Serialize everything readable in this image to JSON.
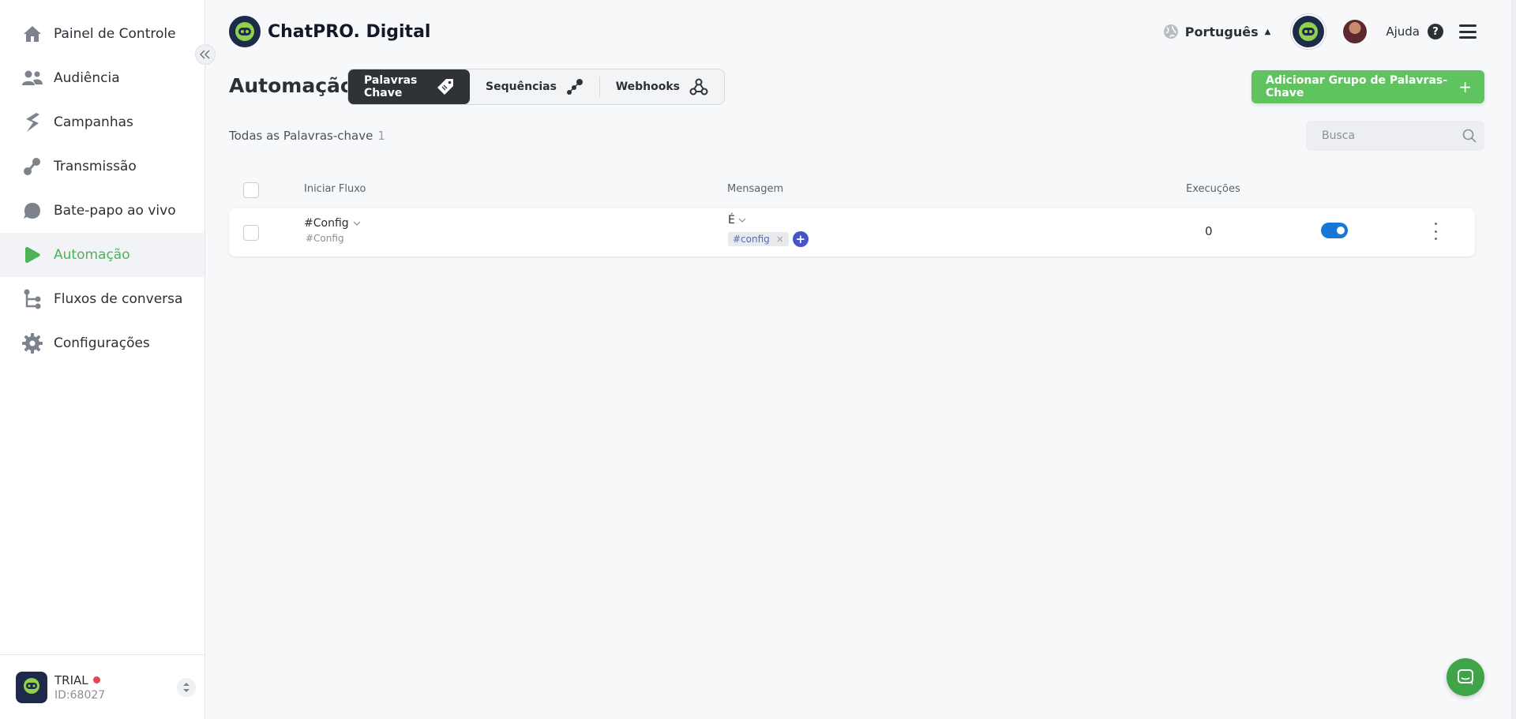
{
  "app": {
    "brand_name": "ChatPRO. Digital"
  },
  "sidebar": {
    "items": [
      {
        "label": "Painel de Controle",
        "icon": "home-icon",
        "active": false
      },
      {
        "label": "Audiência",
        "icon": "users-icon",
        "active": false
      },
      {
        "label": "Campanhas",
        "icon": "campaign-icon",
        "active": false
      },
      {
        "label": "Transmissão",
        "icon": "broadcast-icon",
        "active": false
      },
      {
        "label": "Bate-papo ao vivo",
        "icon": "chat-bubble-icon",
        "active": false
      },
      {
        "label": "Automação",
        "icon": "play-icon",
        "active": true
      },
      {
        "label": "Fluxos de conversa",
        "icon": "flow-icon",
        "active": false
      },
      {
        "label": "Configurações",
        "icon": "gear-icon",
        "active": false
      }
    ],
    "footer": {
      "plan": "TRIAL",
      "account_id": "ID:68027"
    }
  },
  "header": {
    "language": "Português",
    "help_label": "Ajuda"
  },
  "page": {
    "title": "Automação",
    "tabs": [
      {
        "label": "Palavras Chave",
        "active": true
      },
      {
        "label": "Sequências",
        "active": false
      },
      {
        "label": "Webhooks",
        "active": false
      }
    ],
    "add_button_label": "Adicionar Grupo de Palavras-Chave",
    "count_label": "Todas as Palavras-chave",
    "count_value": "1",
    "search_placeholder": "Busca"
  },
  "table": {
    "columns": [
      "Iniciar Fluxo",
      "Mensagem",
      "Execuções"
    ],
    "rows": [
      {
        "flow": "#Config",
        "flow_sub": "#Config",
        "match": "É",
        "keywords": [
          "#config"
        ],
        "executions": "0",
        "enabled": true
      }
    ]
  },
  "colors": {
    "accent_green": "#5fc45f",
    "active_nav": "#4fb257",
    "toggle_on": "#1677d9",
    "keyword_add": "#4654c7"
  }
}
